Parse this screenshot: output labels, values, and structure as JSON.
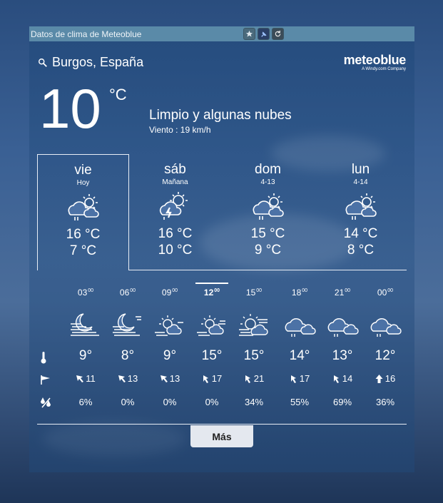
{
  "window": {
    "title": "Datos de clima de Meteoblue",
    "buttons": [
      "star-icon",
      "pin-icon",
      "refresh-icon"
    ]
  },
  "location": "Burgos, España",
  "brand": {
    "name": "meteoblue",
    "tagline": "A Windy.com Company"
  },
  "current": {
    "temp": "10",
    "unit": "°C",
    "condition": "Limpio y algunas nubes",
    "wind": "Viento : 19 km/h"
  },
  "days": [
    {
      "name": "vie",
      "sub": "Hoy",
      "hi": "16 °C",
      "lo": "7 °C",
      "icon": "partly-cloudy-rain-icon"
    },
    {
      "name": "sáb",
      "sub": "Mañana",
      "hi": "16 °C",
      "lo": "10 °C",
      "icon": "thunderstorm-sun-icon"
    },
    {
      "name": "dom",
      "sub": "4-13",
      "hi": "15 °C",
      "lo": "9 °C",
      "icon": "partly-cloudy-rain-icon"
    },
    {
      "name": "lun",
      "sub": "4-14",
      "hi": "14 °C",
      "lo": "8 °C",
      "icon": "partly-cloudy-rain-icon"
    }
  ],
  "hourly": [
    {
      "hour": "03",
      "min": "00",
      "temp": "9°",
      "wind": "11",
      "prec": "6%",
      "icon": "moon-cloud-wind-icon"
    },
    {
      "hour": "06",
      "min": "00",
      "temp": "8°",
      "wind": "13",
      "prec": "0%",
      "icon": "moon-cloud-wind-icon"
    },
    {
      "hour": "09",
      "min": "00",
      "temp": "9°",
      "wind": "13",
      "prec": "0%",
      "icon": "sun-cloud-wind-icon"
    },
    {
      "hour": "12",
      "min": "00",
      "temp": "15°",
      "wind": "17",
      "prec": "0%",
      "icon": "sun-cloud-wind-icon",
      "now": true
    },
    {
      "hour": "15",
      "min": "00",
      "temp": "15°",
      "wind": "21",
      "prec": "34%",
      "icon": "sun-cloud-wind-icon"
    },
    {
      "hour": "18",
      "min": "00",
      "temp": "14°",
      "wind": "17",
      "prec": "55%",
      "icon": "cloud-rain-icon"
    },
    {
      "hour": "21",
      "min": "00",
      "temp": "13°",
      "wind": "14",
      "prec": "69%",
      "icon": "cloud-rain-icon"
    },
    {
      "hour": "00",
      "min": "00",
      "temp": "12°",
      "wind": "16",
      "prec": "36%",
      "icon": "cloud-rain-icon"
    }
  ],
  "row_icons": [
    "thermometer-icon",
    "wind-flag-icon",
    "precipitation-icon"
  ],
  "more_label": "Más"
}
